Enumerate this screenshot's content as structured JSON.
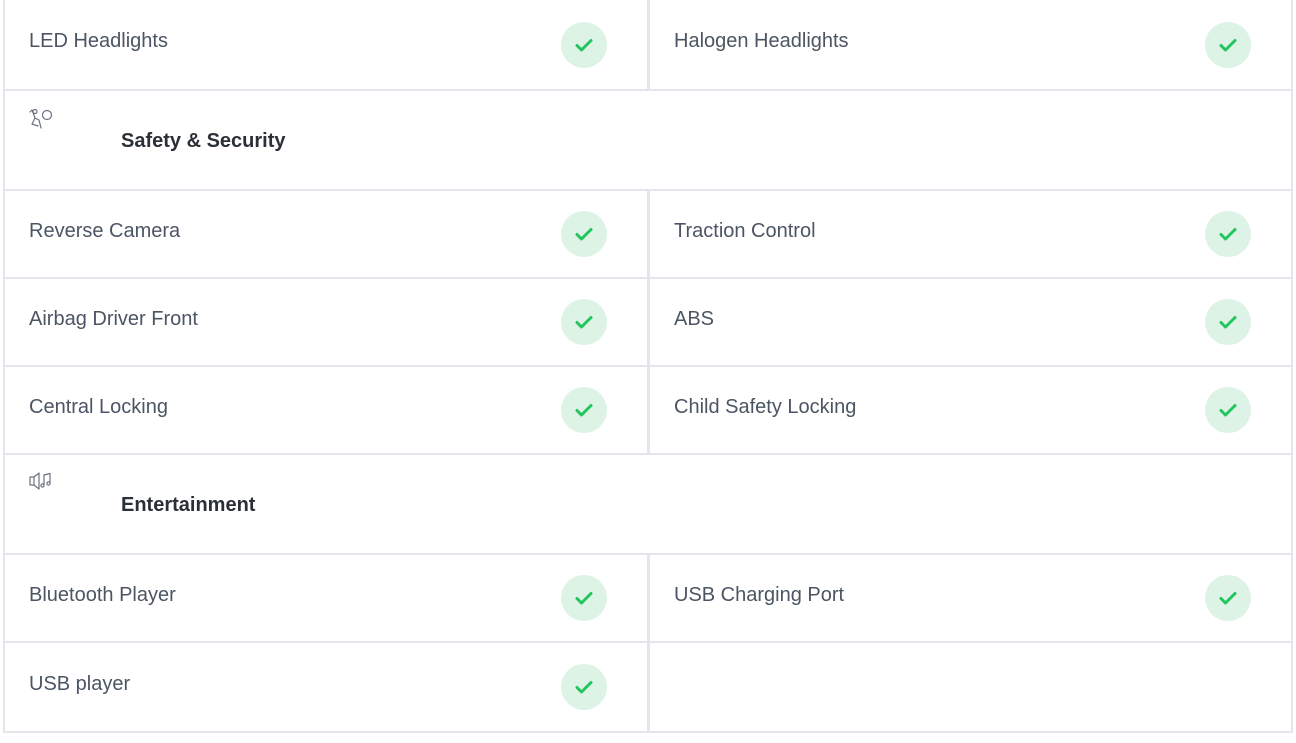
{
  "colors": {
    "check_bg": "#ddf3e6",
    "check_mark": "#22c55e",
    "border": "#e3e7ec"
  },
  "top_row": {
    "left": {
      "label": "LED Headlights",
      "checked": true
    },
    "right": {
      "label": "Halogen Headlights",
      "checked": true
    }
  },
  "sections": [
    {
      "title": "Safety & Security",
      "icon": "seat-airbag-icon",
      "rows": [
        {
          "left": {
            "label": "Reverse Camera",
            "checked": true
          },
          "right": {
            "label": "Traction Control",
            "checked": true
          }
        },
        {
          "left": {
            "label": "Airbag Driver Front",
            "checked": true
          },
          "right": {
            "label": "ABS",
            "checked": true
          }
        },
        {
          "left": {
            "label": "Central Locking",
            "checked": true
          },
          "right": {
            "label": "Child Safety Locking",
            "checked": true
          }
        }
      ]
    },
    {
      "title": "Entertainment",
      "icon": "speaker-music-icon",
      "rows": [
        {
          "left": {
            "label": "Bluetooth Player",
            "checked": true
          },
          "right": {
            "label": "USB Charging Port",
            "checked": true
          }
        },
        {
          "left": {
            "label": "USB player",
            "checked": true
          },
          "right": null
        }
      ]
    }
  ]
}
